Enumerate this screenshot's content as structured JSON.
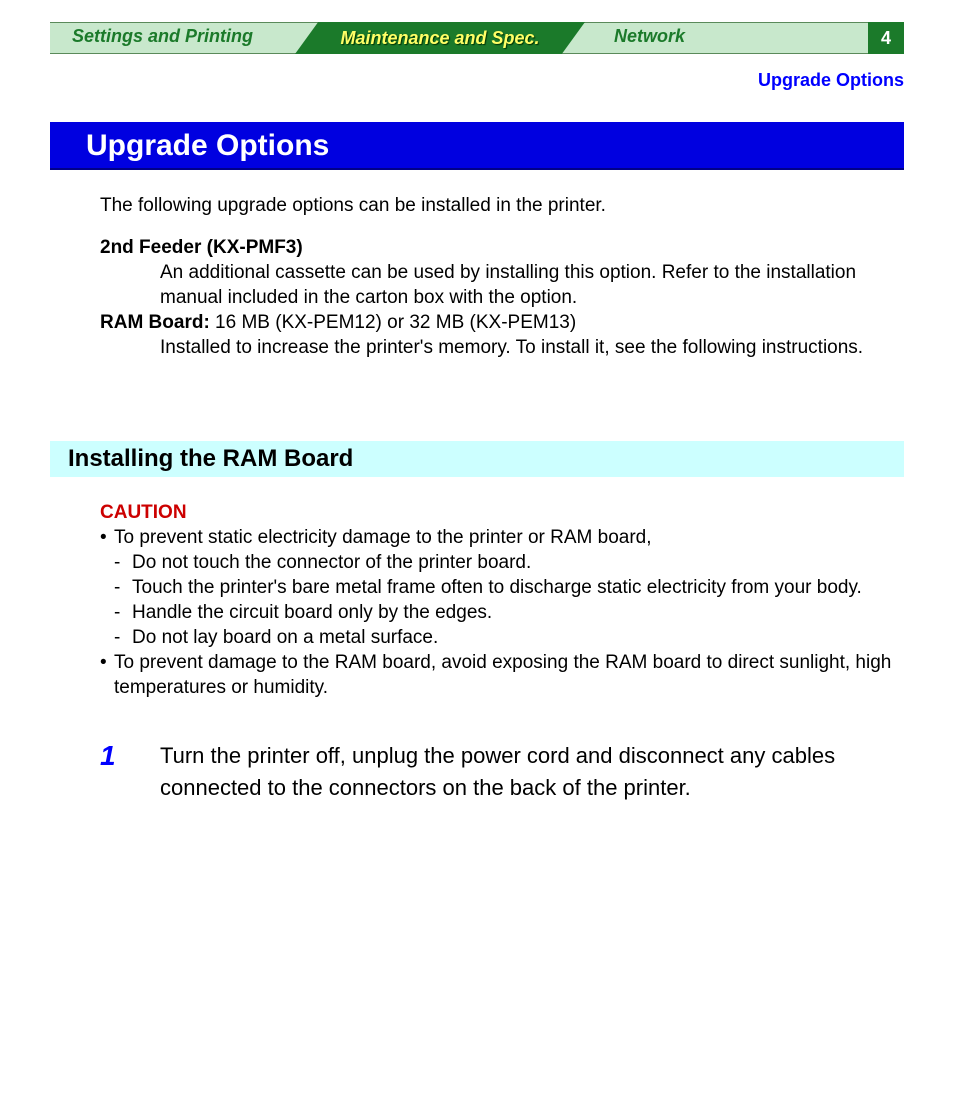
{
  "nav": {
    "tab1": "Settings and Printing",
    "tab2": "Maintenance and Spec.",
    "tab3": "Network",
    "pageNumber": "4"
  },
  "breadcrumb": "Upgrade Options",
  "heading1": "Upgrade Options",
  "intro": "The following upgrade options can be installed in the printer.",
  "option1": {
    "label": "2nd Feeder (KX-PMF3)",
    "desc": "An additional cassette can be used by installing this option. Refer to the installation manual included in the carton box with the option."
  },
  "option2": {
    "labelPrefix": "RAM Board:",
    "labelRest": " 16 MB (KX-PEM12) or 32 MB (KX-PEM13)",
    "desc": "Installed to increase the printer's memory. To install it, see the following instructions."
  },
  "heading2": "Installing the RAM Board",
  "caution": {
    "label": "CAUTION",
    "b1": "To prevent static electricity damage to the printer or RAM board,",
    "d1": "Do not touch the connector of the printer board.",
    "d2": "Touch the printer's bare metal frame often to discharge static electricity from your body.",
    "d3": "Handle the circuit board only by the edges.",
    "d4": "Do not lay board on a metal surface.",
    "b2": "To prevent damage to the RAM board, avoid exposing the RAM board to direct sunlight, high temperatures or humidity."
  },
  "step1": {
    "num": "1",
    "text": "Turn the printer off, unplug the power cord and disconnect any cables connected to the connectors on the back of the printer."
  }
}
